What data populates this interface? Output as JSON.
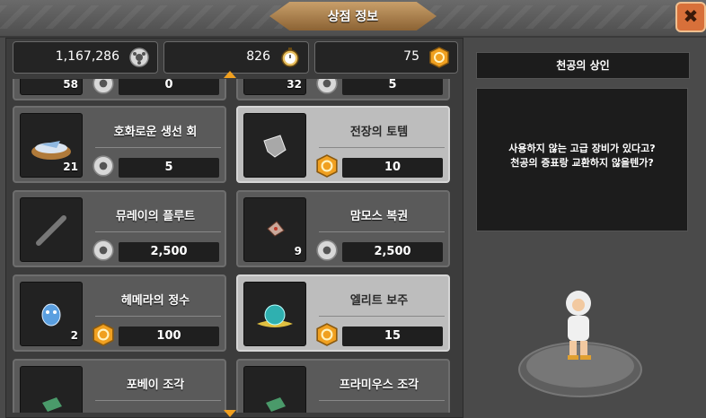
{
  "title": "상점 정보",
  "currencies": [
    {
      "value": "1,167,286",
      "icon": "gear-coin-icon"
    },
    {
      "value": "826",
      "icon": "stopwatch-icon"
    },
    {
      "value": "75",
      "icon": "gold-emblem-icon"
    }
  ],
  "items": [
    {
      "name": "",
      "qty": "58",
      "price": "0",
      "currency": "gear-coin-icon",
      "selected": false
    },
    {
      "name": "",
      "qty": "32",
      "price": "5",
      "currency": "gear-coin-icon",
      "selected": false
    },
    {
      "name": "호화로운 생선 회",
      "qty": "21",
      "price": "5",
      "currency": "gear-coin-icon",
      "selected": false
    },
    {
      "name": "전장의 토템",
      "qty": "",
      "price": "10",
      "currency": "gold-emblem-icon",
      "selected": true
    },
    {
      "name": "뮤레이의 플루트",
      "qty": "",
      "price": "2,500",
      "currency": "gear-coin-icon",
      "selected": false
    },
    {
      "name": "맘모스 복권",
      "qty": "9",
      "price": "2,500",
      "currency": "gear-coin-icon",
      "selected": false
    },
    {
      "name": "헤메라의 정수",
      "qty": "2",
      "price": "100",
      "currency": "gold-emblem-icon",
      "selected": false
    },
    {
      "name": "엘리트 보주",
      "qty": "",
      "price": "15",
      "currency": "gold-emblem-icon",
      "selected": true
    },
    {
      "name": "포베이 조각",
      "qty": "",
      "price": "",
      "currency": "gear-coin-icon",
      "selected": false
    },
    {
      "name": "프라미우스 조각",
      "qty": "",
      "price": "",
      "currency": "gear-coin-icon",
      "selected": false
    }
  ],
  "npc": {
    "name": "천공의 상인",
    "line1": "사용하지 않는 고급 장비가 있다고?",
    "line2": "천공의 증표랑 교환하지 않을텐가?"
  }
}
